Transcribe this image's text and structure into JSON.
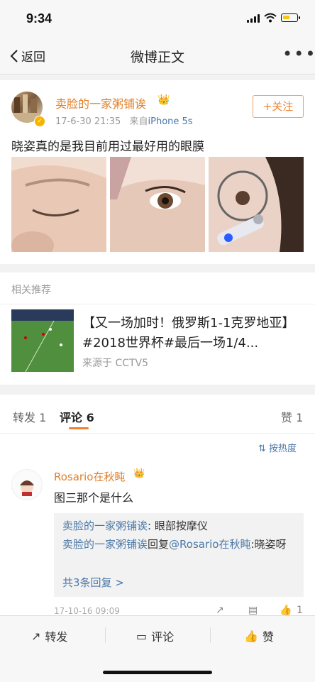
{
  "status": {
    "time": "9:34"
  },
  "nav": {
    "back_label": "返回",
    "title": "微博正文",
    "more": "•••"
  },
  "post": {
    "author": "卖脸的一家粥铺诶",
    "time": "17-6-30 21:35",
    "source_prefix": "来自",
    "source": "iPhone 5s",
    "follow_label": "+关注",
    "text": "晓姿真的是我目前用过最好用的眼膜"
  },
  "related": {
    "header": "相关推荐",
    "title": "【又一场加时！俄罗斯1-1克罗地亚】#2018世界杯#最后一场1/4...",
    "source": "来源于 CCTV5"
  },
  "comments": {
    "tabs": {
      "repost": "转发 1",
      "comment": "评论 6",
      "like": "赞 1"
    },
    "sort_label": "按热度",
    "comment": {
      "name": "Rosario在秋盹",
      "text": "图三那个是什么",
      "replies": [
        {
          "user": "卖脸的一家粥铺诶",
          "sep": ": ",
          "text": "眼部按摩仪"
        },
        {
          "user": "卖脸的一家粥铺诶",
          "mid": "回复",
          "mention": "@Rosario在秋盹",
          "text": ":晓姿呀"
        }
      ],
      "more_replies": "共3条回复 >",
      "time": "17-10-16 09:09",
      "likes": "1"
    }
  },
  "toolbar": {
    "repost": "转发",
    "comment": "评论",
    "like": "赞"
  }
}
